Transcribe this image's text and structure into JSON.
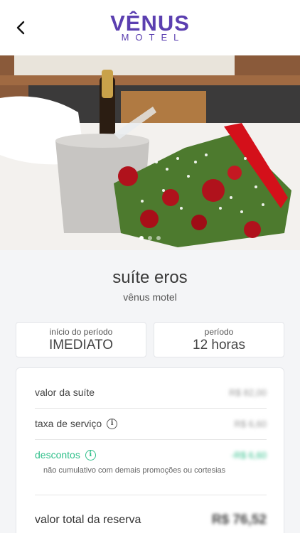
{
  "header": {
    "back_icon": "chevron-left-icon",
    "logo_main": "VÊNUS",
    "logo_sub": "MOTEL",
    "brand_color": "#5b3fb0"
  },
  "hero": {
    "slides_total": 3,
    "active_slide": 1
  },
  "suite": {
    "name": "suíte eros",
    "motel": "vênus motel"
  },
  "period_start": {
    "label": "início do período",
    "value": "IMEDIATO"
  },
  "period": {
    "label": "período",
    "value": "12 horas"
  },
  "pricing": {
    "suite_value_label": "valor da suíte",
    "suite_value": "R$ 82,00",
    "service_fee_label": "taxa de serviço",
    "service_fee": "R$ 6,60",
    "discount_label": "descontos",
    "discount": "-R$ 6,60",
    "discount_note": "não cumulativo com demais promoções ou cortesias",
    "total_label": "valor total da reserva",
    "total": "R$ 76,52",
    "accent_color": "#2fbf8a"
  }
}
